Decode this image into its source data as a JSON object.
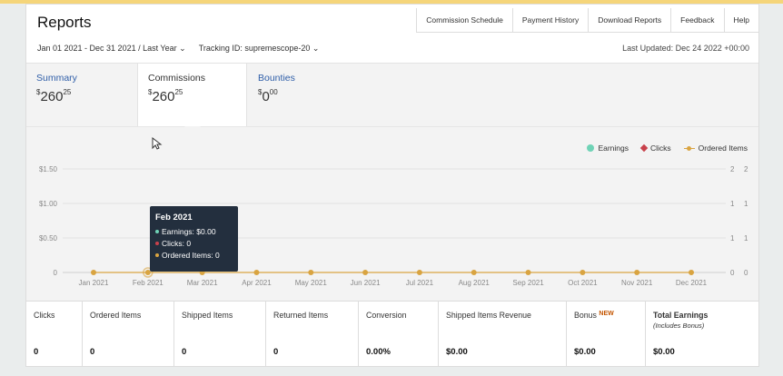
{
  "header": {
    "title": "Reports",
    "actions": [
      "Commission Schedule",
      "Payment History",
      "Download Reports",
      "Feedback",
      "Help"
    ],
    "date_range": "Jan 01 2021 - Dec 31 2021 / Last Year",
    "tracking_id": "Tracking ID: supremescope-20",
    "last_updated": "Last Updated: Dec 24 2022 +00:00"
  },
  "tabs": [
    {
      "label": "Summary",
      "dollars": "260",
      "cents": "25"
    },
    {
      "label": "Commissions",
      "dollars": "260",
      "cents": "25"
    },
    {
      "label": "Bounties",
      "dollars": "0",
      "cents": "00"
    }
  ],
  "legend": {
    "earnings": "Earnings",
    "clicks": "Clicks",
    "ordered": "Ordered Items"
  },
  "tooltip": {
    "title": "Feb 2021",
    "earnings": "Earnings: $0.00",
    "clicks": "Clicks: 0",
    "ordered": "Ordered Items: 0"
  },
  "chart_data": {
    "type": "line",
    "categories": [
      "Jan 2021",
      "Feb 2021",
      "Mar 2021",
      "Apr 2021",
      "May 2021",
      "Jun 2021",
      "Jul 2021",
      "Aug 2021",
      "Sep 2021",
      "Oct 2021",
      "Nov 2021",
      "Dec 2021"
    ],
    "left_ticks": [
      "0",
      "$0.50",
      "$1.00",
      "$1.50"
    ],
    "right_ticks_a": [
      "0",
      "1",
      "1",
      "2"
    ],
    "right_ticks_b": [
      "0",
      "1",
      "1",
      "2"
    ],
    "series": [
      {
        "name": "Earnings",
        "values": [
          0,
          0,
          0,
          0,
          0,
          0,
          0,
          0,
          0,
          0,
          0,
          0
        ]
      },
      {
        "name": "Clicks",
        "values": [
          0,
          0,
          0,
          0,
          0,
          0,
          0,
          0,
          0,
          0,
          0,
          0
        ]
      },
      {
        "name": "Ordered Items",
        "values": [
          0,
          0,
          0,
          0,
          0,
          0,
          0,
          0,
          0,
          0,
          0,
          0
        ]
      }
    ],
    "ylim": [
      0,
      1.5
    ],
    "grid": true,
    "legend_position": "top-right"
  },
  "colors": {
    "earnings": "#6fd3b6",
    "clicks": "#c8414b",
    "ordered": "#d9a441",
    "tab_link": "#2f5ea8",
    "tooltip_bg": "#232f3e"
  },
  "stats": [
    {
      "label": "Clicks",
      "value": "0"
    },
    {
      "label": "Ordered Items",
      "value": "0"
    },
    {
      "label": "Shipped Items",
      "value": "0"
    },
    {
      "label": "Returned Items",
      "value": "0"
    },
    {
      "label": "Conversion",
      "value": "0.00%"
    },
    {
      "label": "Shipped Items Revenue",
      "value": "$0.00"
    },
    {
      "label": "Bonus",
      "badge": "NEW",
      "value": "$0.00"
    },
    {
      "label": "Total Earnings",
      "sub": "(Includes Bonus)",
      "value": "$0.00"
    }
  ]
}
